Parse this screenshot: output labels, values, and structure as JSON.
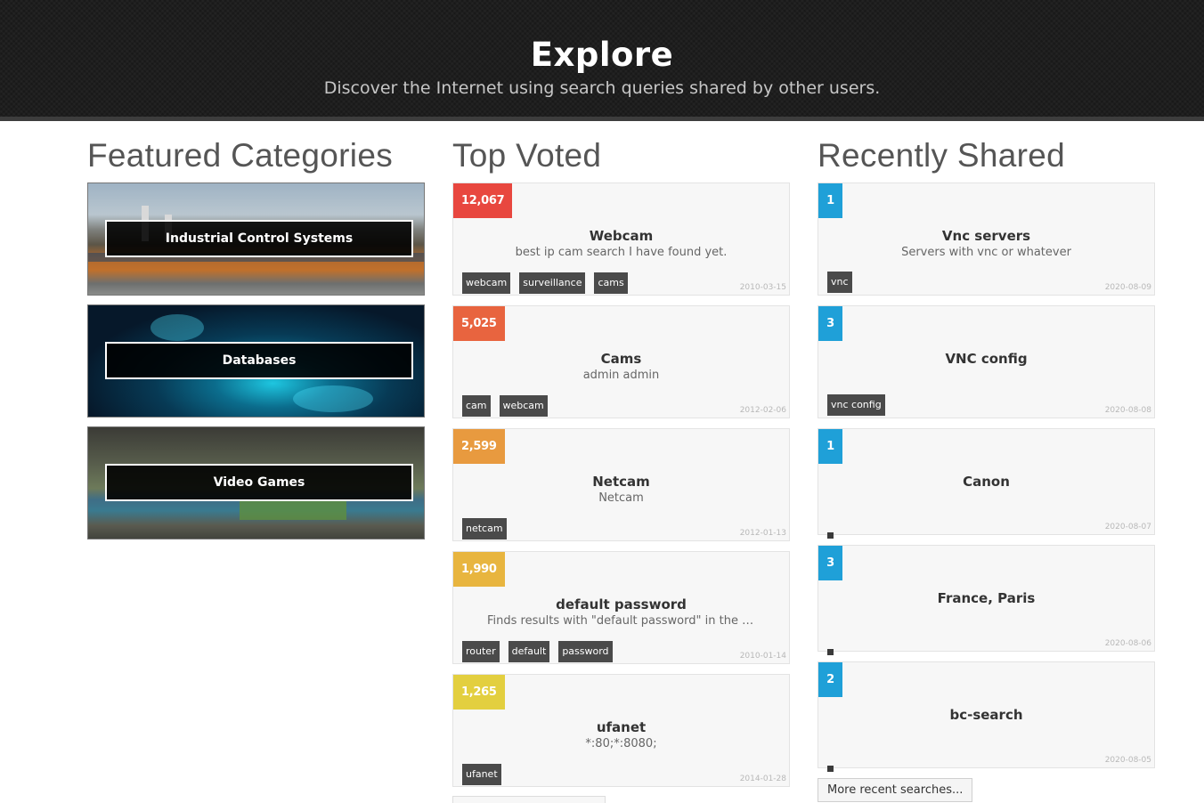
{
  "hero": {
    "title": "Explore",
    "subtitle": "Discover the Internet using search queries shared by other users."
  },
  "featured": {
    "heading": "Featured Categories",
    "categories": [
      {
        "label": "Industrial Control Systems"
      },
      {
        "label": "Databases"
      },
      {
        "label": "Video Games"
      }
    ]
  },
  "top_voted": {
    "heading": "Top Voted",
    "items": [
      {
        "votes": "12,067",
        "color": "#e8473f",
        "title": "Webcam",
        "description": "best ip cam search I have found yet.",
        "tags": [
          "webcam",
          "surveillance",
          "cams"
        ],
        "date": "2010-03-15"
      },
      {
        "votes": "5,025",
        "color": "#e8643f",
        "title": "Cams",
        "description": "admin admin",
        "tags": [
          "cam",
          "webcam"
        ],
        "date": "2012-02-06"
      },
      {
        "votes": "2,599",
        "color": "#e89a3f",
        "title": "Netcam",
        "description": "Netcam",
        "tags": [
          "netcam"
        ],
        "date": "2012-01-13"
      },
      {
        "votes": "1,990",
        "color": "#e8b53f",
        "title": "default password",
        "description": "Finds results with \"default password\" in the ba...",
        "tags": [
          "router",
          "default",
          "password"
        ],
        "date": "2010-01-14"
      },
      {
        "votes": "1,265",
        "color": "#e3cf3f",
        "title": "ufanet",
        "description": "*:80;*:8080;",
        "tags": [
          "ufanet"
        ],
        "date": "2014-01-28"
      }
    ]
  },
  "recently_shared": {
    "heading": "Recently Shared",
    "badge_color": "#1fa0d8",
    "items": [
      {
        "votes": "1",
        "title": "Vnc servers",
        "description": "Servers with vnc or whatever",
        "tags": [
          "vnc"
        ],
        "date": "2020-08-09"
      },
      {
        "votes": "3",
        "title": "VNC config",
        "description": "",
        "tags": [
          "vnc config"
        ],
        "date": "2020-08-08"
      },
      {
        "votes": "1",
        "title": "Canon",
        "description": "",
        "tags": [
          ""
        ],
        "date": "2020-08-07"
      },
      {
        "votes": "3",
        "title": "France, Paris",
        "description": "",
        "tags": [
          ""
        ],
        "date": "2020-08-06"
      },
      {
        "votes": "2",
        "title": "bc-search",
        "description": "",
        "tags": [
          ""
        ],
        "date": "2020-08-05"
      }
    ],
    "more_label": "More recent searches..."
  }
}
